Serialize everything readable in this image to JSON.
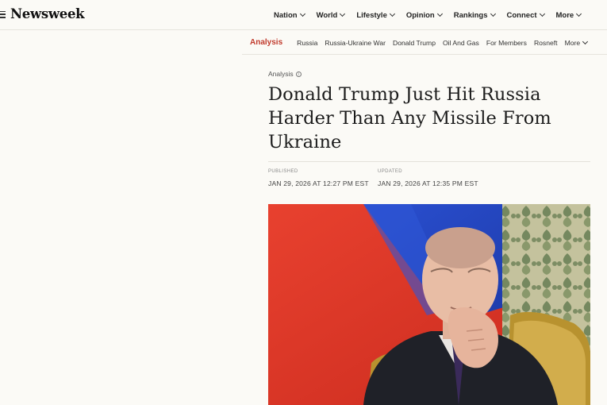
{
  "header": {
    "logo": "Newsweek",
    "menu_icon": "hamburger-menu-icon",
    "nav": [
      {
        "label": "Nation"
      },
      {
        "label": "World"
      },
      {
        "label": "Lifestyle"
      },
      {
        "label": "Opinion"
      },
      {
        "label": "Rankings"
      },
      {
        "label": "Connect"
      },
      {
        "label": "More"
      }
    ]
  },
  "subnav": {
    "section": "Analysis",
    "items": [
      "Russia",
      "Russia-Ukraine War",
      "Donald Trump",
      "Oil And Gas",
      "For Members",
      "Rosneft"
    ],
    "more": "More"
  },
  "article": {
    "kicker": "Analysis",
    "info_icon": "info-icon",
    "headline_line1": "Donald Trump Just Hit Russia",
    "headline_line2": "Harder Than Any Missile From",
    "headline_line3": "Ukraine",
    "published_label": "PUBLISHED",
    "published_value": "JAN 29, 2026 AT 12:27 PM EST",
    "updated_label": "UPDATED",
    "updated_value": "JAN 29, 2026 AT 12:35 PM EST"
  },
  "colors": {
    "accent": "#c0392b",
    "background": "#fbfaf6"
  }
}
